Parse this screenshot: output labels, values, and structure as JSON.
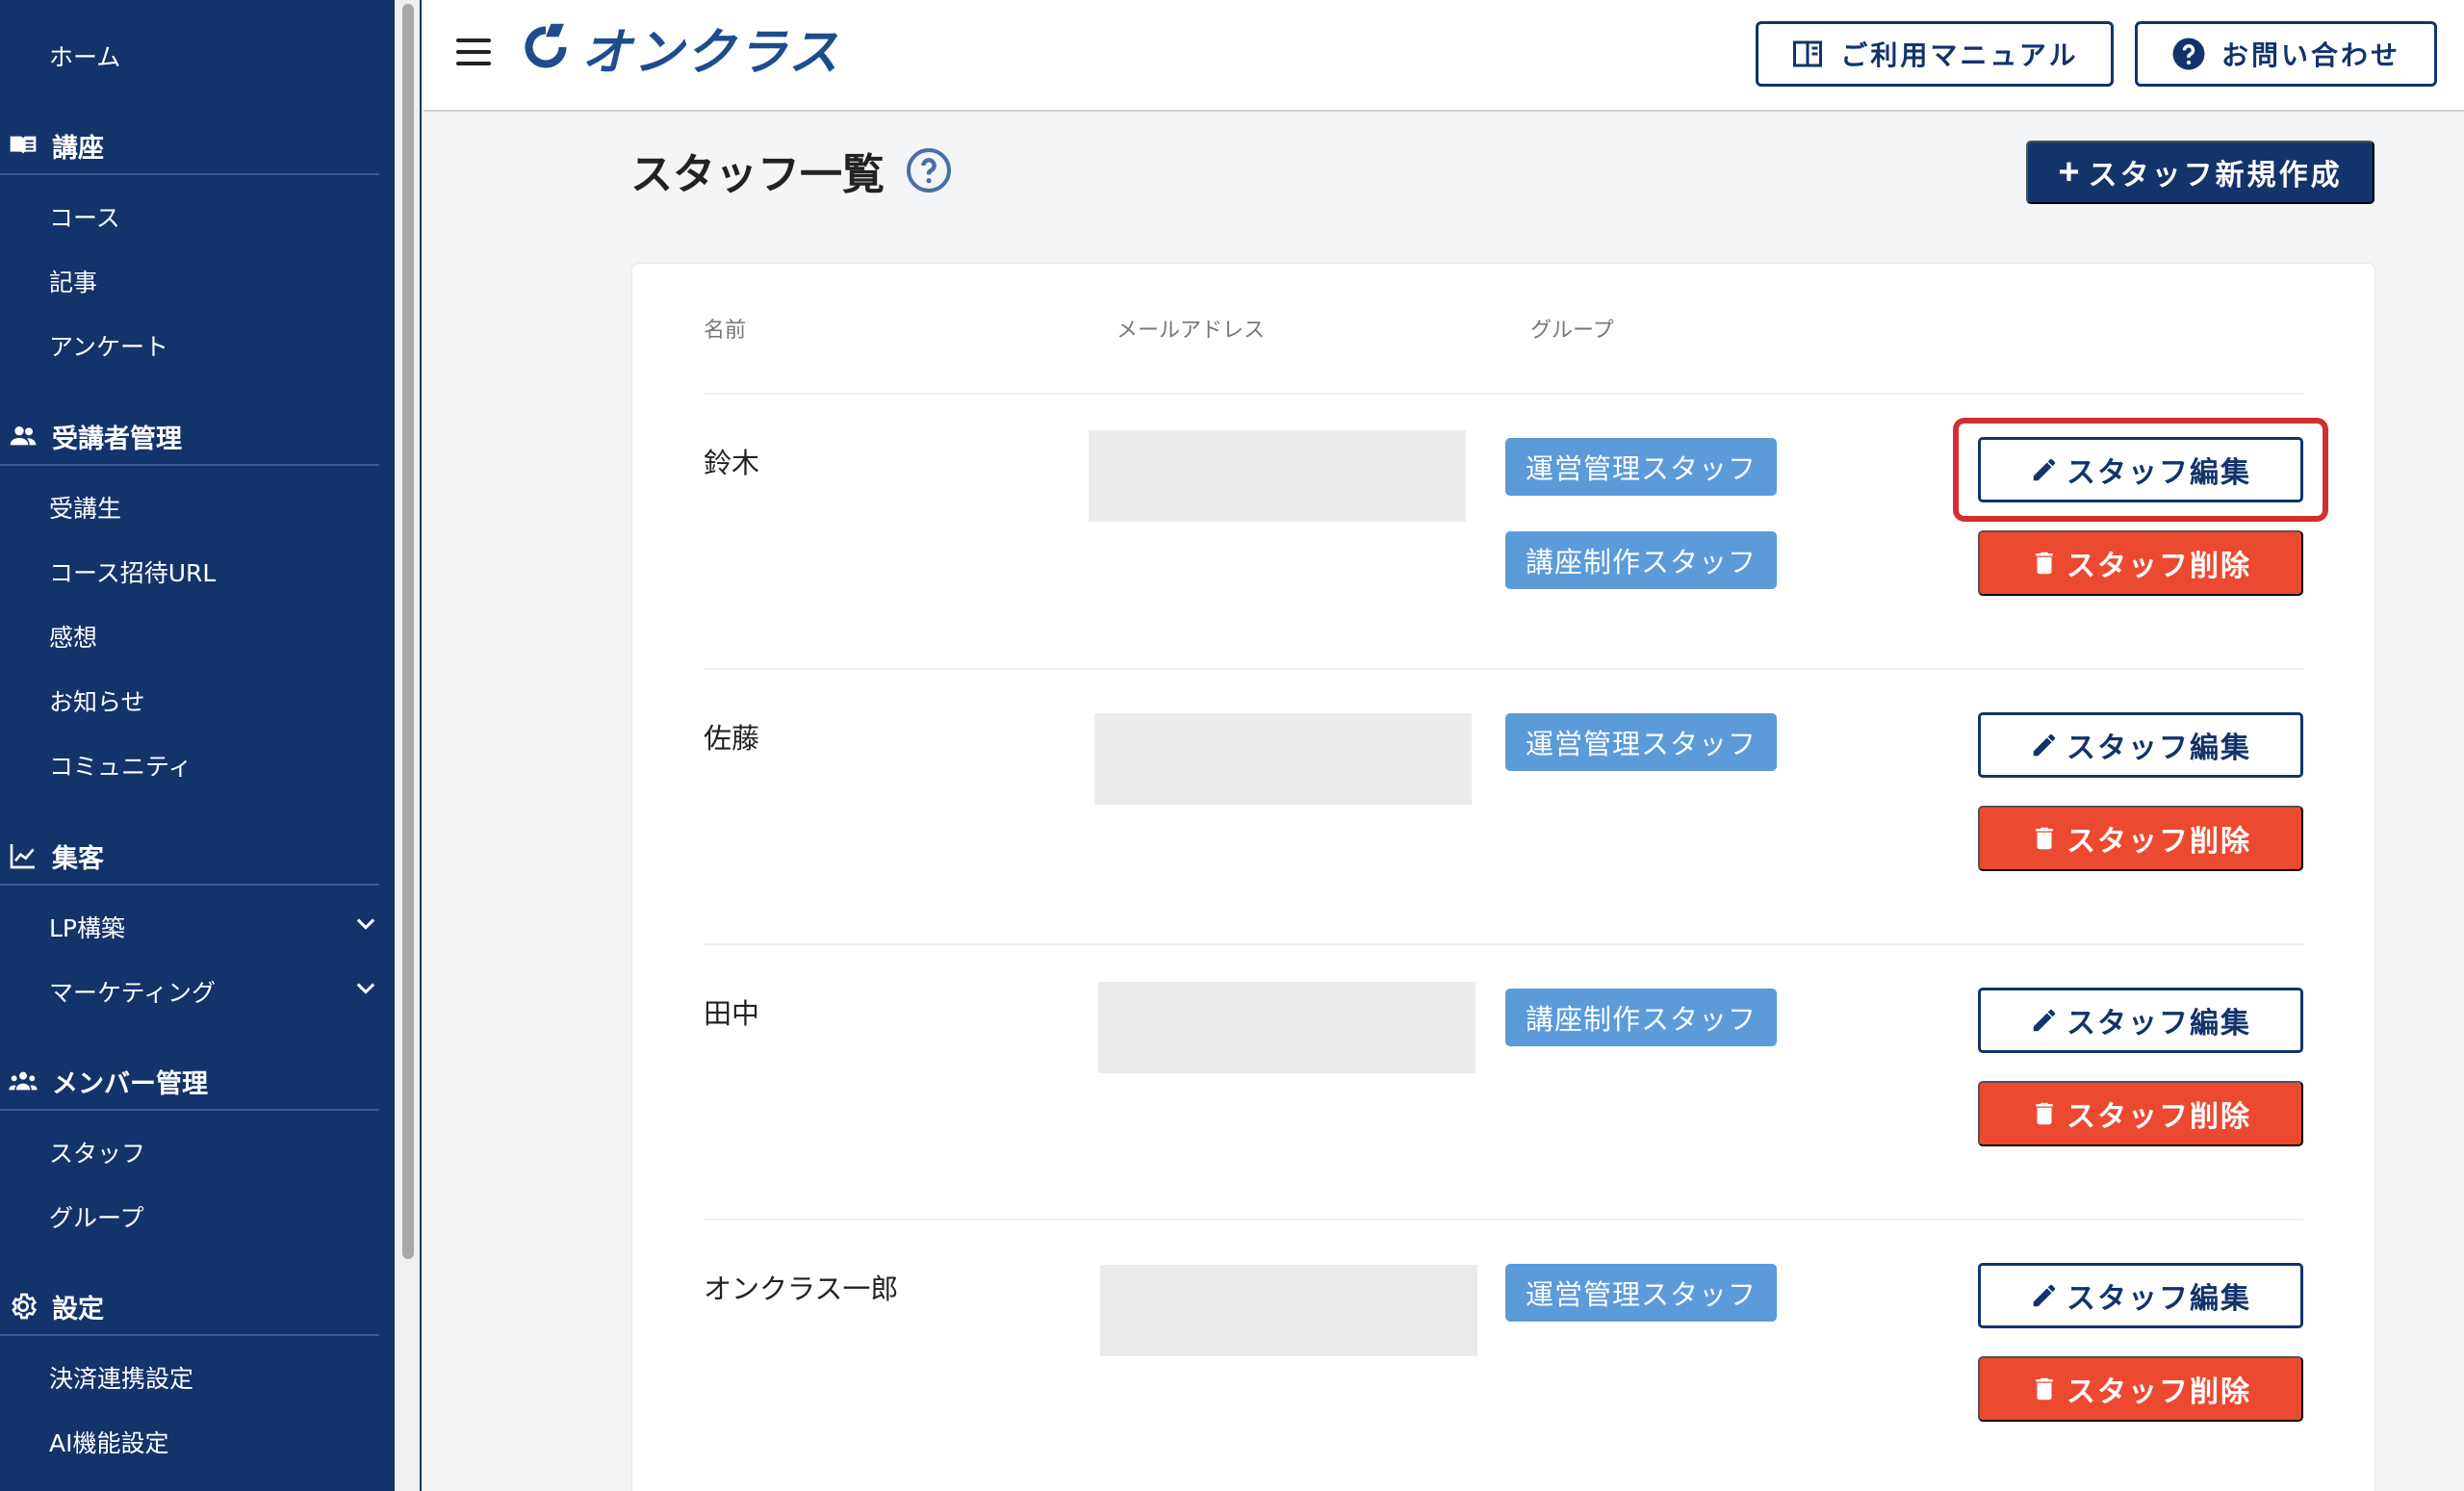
{
  "sidebar": {
    "home": "ホーム",
    "courses": {
      "title": "講座",
      "items": [
        "コース",
        "記事",
        "アンケート"
      ]
    },
    "learners": {
      "title": "受講者管理",
      "items": [
        "受講生",
        "コース招待URL",
        "感想",
        "お知らせ",
        "コミュニティ"
      ]
    },
    "marketing": {
      "title": "集客",
      "items": [
        "LP構築",
        "マーケティング"
      ]
    },
    "members": {
      "title": "メンバー管理",
      "items": [
        "スタッフ",
        "グループ"
      ]
    },
    "settings": {
      "title": "設定",
      "items": [
        "決済連携設定",
        "AI機能設定"
      ]
    }
  },
  "header": {
    "logo_text": "オンクラス",
    "manual_label": "ご利用マニュアル",
    "contact_label": "お問い合わせ"
  },
  "main": {
    "title": "スタッフ一覧",
    "create_label": "スタッフ新規作成",
    "columns": [
      "名前",
      "メールアドレス",
      "グループ"
    ],
    "edit_label": "スタッフ編集",
    "delete_label": "スタッフ削除",
    "rows": [
      {
        "name": "鈴木",
        "groups": [
          "運営管理スタッフ",
          "講座制作スタッフ"
        ]
      },
      {
        "name": "佐藤",
        "groups": [
          "運営管理スタッフ"
        ]
      },
      {
        "name": "田中",
        "groups": [
          "講座制作スタッフ"
        ]
      },
      {
        "name": "オンクラス一郎",
        "groups": [
          "運営管理スタッフ"
        ]
      }
    ]
  },
  "colors": {
    "sidebar_bg": "#13336b",
    "primary": "#13336b",
    "group_tag": "#5b9bd9",
    "danger": "#ec4a30",
    "highlight": "#d32f2f"
  }
}
